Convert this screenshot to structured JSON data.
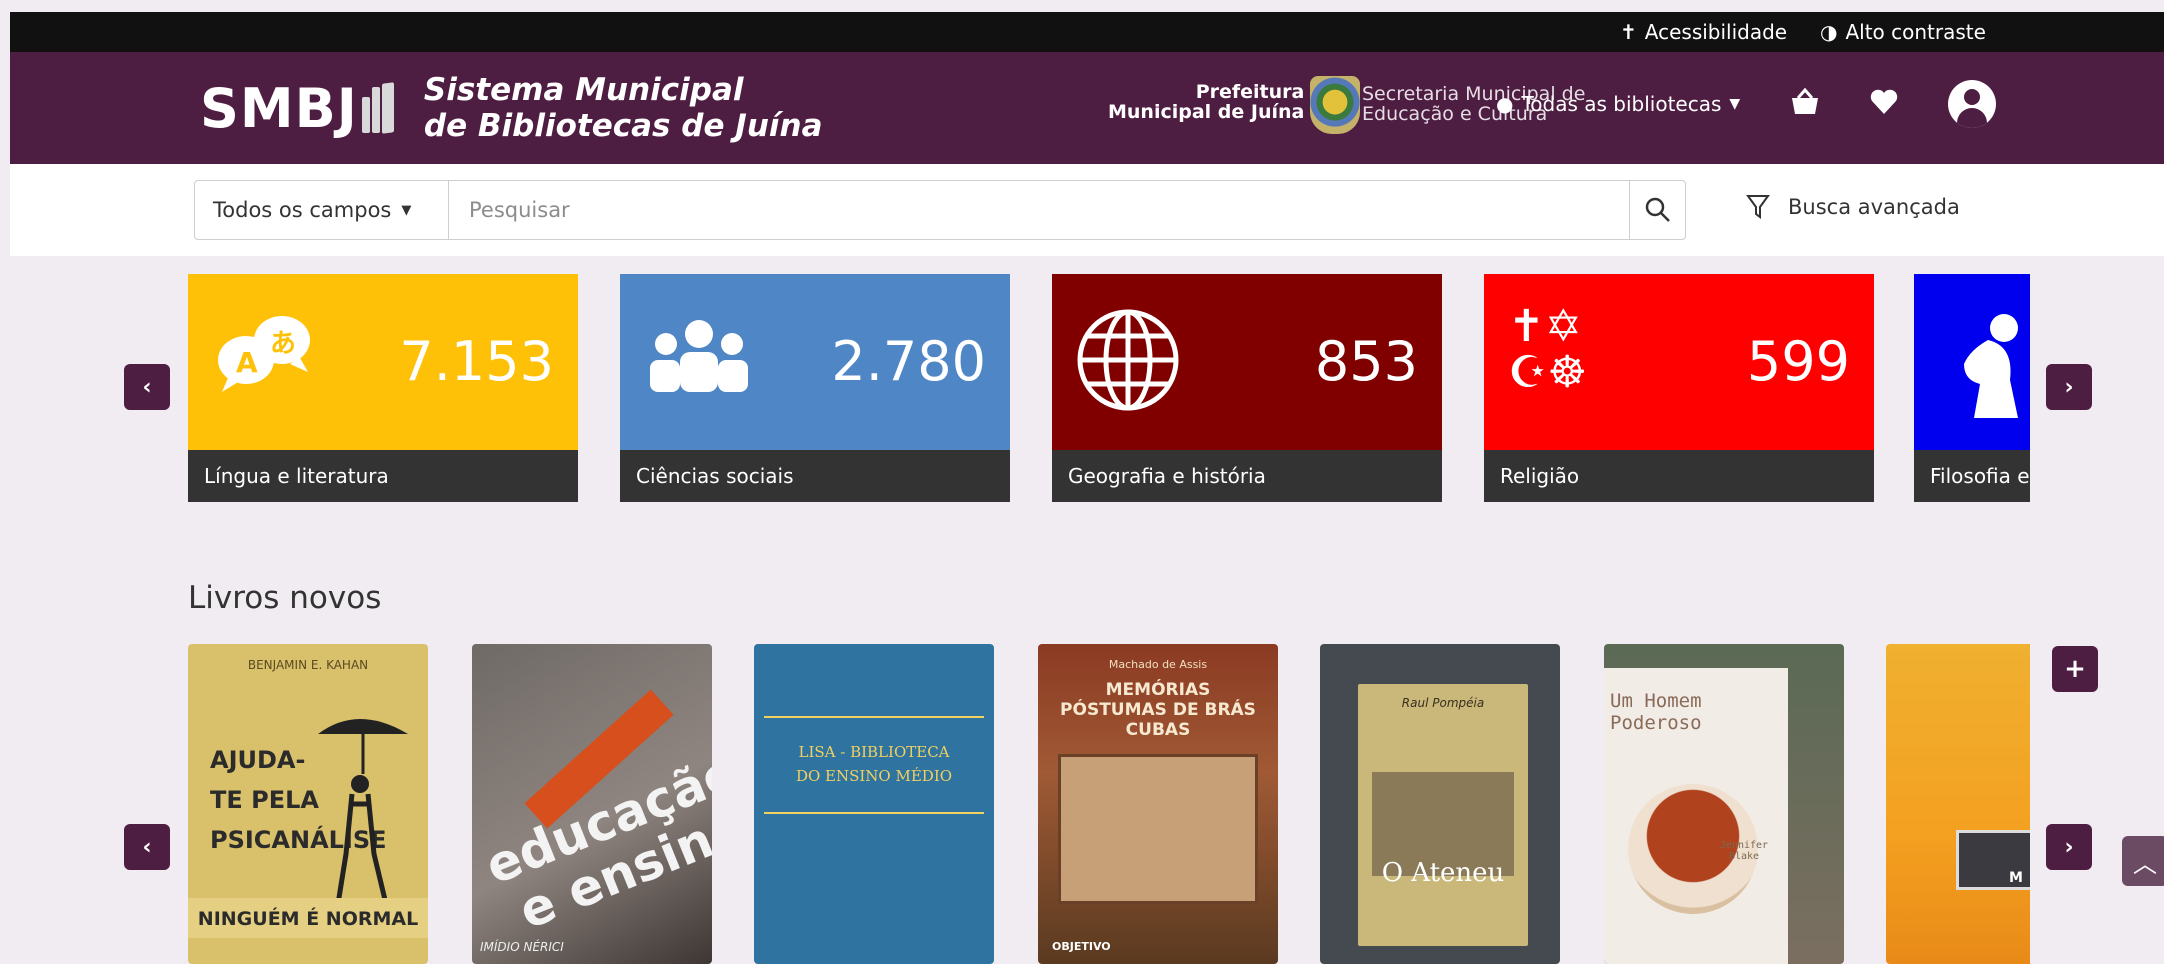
{
  "accessibility_bar": {
    "accessibility_label": "Acessibilidade",
    "contrast_label": "Alto contraste"
  },
  "header": {
    "logo_text": "SMBJ",
    "title_line1": "Sistema Municipal",
    "title_line2": "de Bibliotecas de Juína",
    "prefeitura_line1": "Prefeitura",
    "prefeitura_line2": "Municipal de Juína",
    "secretaria_line1": "Secretaria Municipal de",
    "secretaria_line2": "Educação e Cultura",
    "library_selector": "Todas as bibliotecas"
  },
  "search": {
    "field_selector": "Todos os campos",
    "placeholder": "Pesquisar",
    "advanced_label": "Busca avançada"
  },
  "categories": [
    {
      "label": "Língua e literatura",
      "count": "7.153",
      "color": "#ffc107",
      "icon": "language-icon"
    },
    {
      "label": "Ciências sociais",
      "count": "2.780",
      "color": "#4f86c6",
      "icon": "people-icon"
    },
    {
      "label": "Geografia e história",
      "count": "853",
      "color": "#800000",
      "icon": "globe-icon"
    },
    {
      "label": "Religião",
      "count": "599",
      "color": "#ff0000",
      "icon": "religion-icon"
    },
    {
      "label": "Filosofia e",
      "count": "",
      "color": "#0000ee",
      "icon": "thinker-icon"
    }
  ],
  "new_books": {
    "title": "Livros novos",
    "items": [
      {
        "author": "BENJAMIN E. KAHAN",
        "title": "AJUDA-TE PELA PSICANÁLISE",
        "subtitle": "NINGUÉM É NORMAL"
      },
      {
        "author": "IMÍDIO NÉRICI",
        "title": "educação e ensino",
        "subtitle": ""
      },
      {
        "author": "",
        "title": "LISA - BIBLIOTECA DO ENSINO MÉDIO",
        "subtitle": ""
      },
      {
        "author": "Machado de Assis",
        "title": "MEMÓRIAS PÓSTUMAS DE BRÁS CUBAS",
        "subtitle": "OBJETIVO"
      },
      {
        "author": "Raul Pompéia",
        "title": "O Ateneu",
        "subtitle": ""
      },
      {
        "author": "Jennifer Blake",
        "title": "Um Homem Poderoso",
        "subtitle": ""
      },
      {
        "author": "",
        "title": "",
        "subtitle": "M"
      }
    ]
  }
}
